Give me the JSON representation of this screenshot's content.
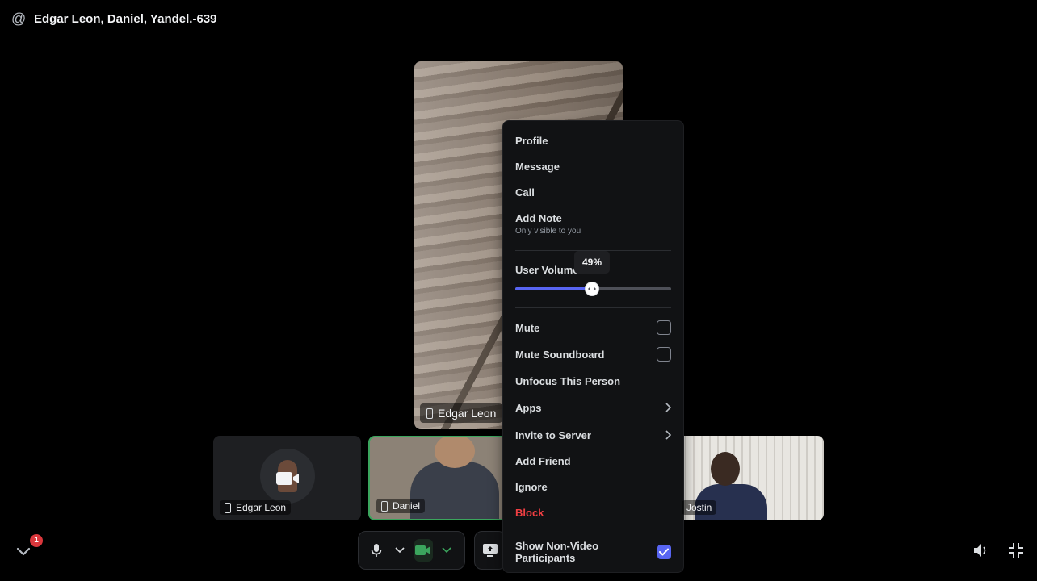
{
  "header": {
    "title": "Edgar Leon, Daniel, Yandel.-639",
    "icon": "at-icon"
  },
  "main_video": {
    "label": "Edgar Leon"
  },
  "tiles": [
    {
      "label": "Edgar Leon"
    },
    {
      "label": "Daniel"
    },
    {
      "label": "Jostin"
    }
  ],
  "notifications": {
    "badge": "1"
  },
  "context_menu": {
    "items": {
      "profile": "Profile",
      "message": "Message",
      "call": "Call",
      "add_note": "Add Note",
      "add_note_sub": "Only visible to you",
      "user_volume": "User Volume",
      "mute": "Mute",
      "mute_soundboard": "Mute Soundboard",
      "unfocus": "Unfocus This Person",
      "apps": "Apps",
      "invite": "Invite to Server",
      "add_friend": "Add Friend",
      "ignore": "Ignore",
      "block": "Block",
      "show_non_video": "Show Non-Video Participants"
    },
    "volume": {
      "value": 0.49,
      "label": "49%"
    },
    "checkboxes": {
      "mute": false,
      "mute_soundboard": false,
      "show_non_video": true
    }
  },
  "colors": {
    "accent": "#5865f2",
    "danger": "#f23f43",
    "speaking": "#3ba55d",
    "badge": "#da373c"
  }
}
